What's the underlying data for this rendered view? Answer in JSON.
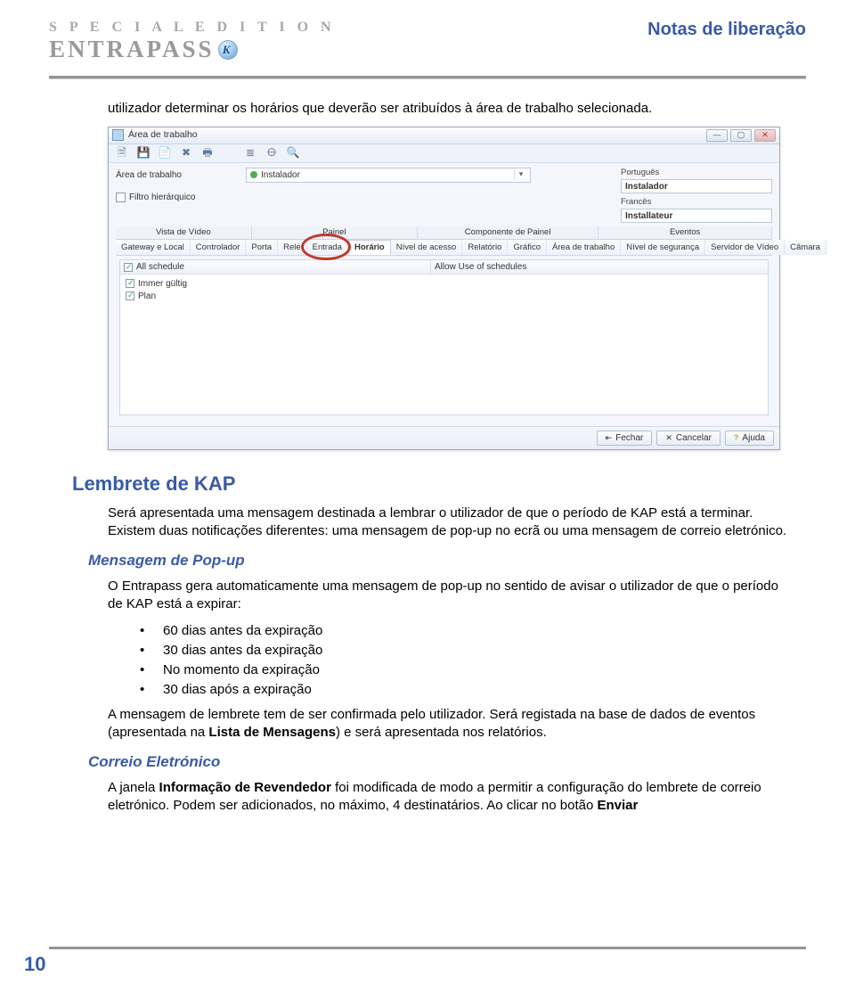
{
  "header": {
    "special_edition": "S P E C I A L   E D I T I O N",
    "brand": "ENTRAPASS",
    "brand_icon_letter": "K",
    "release_notes": "Notas de liberação"
  },
  "intro_paragraph": "utilizador determinar os horários que deverão ser atribuídos à área de trabalho selecionada.",
  "screenshot": {
    "window_title": "Área de trabalho",
    "toolbar_icons": [
      "new",
      "save",
      "folder",
      "delete",
      "print",
      "list",
      "org",
      "search"
    ],
    "labels": {
      "area_de_trabalho": "Área de trabalho",
      "filtro": "Filtro hierárquico"
    },
    "combo_value": "Instalador",
    "lang": {
      "pt_label": "Português",
      "pt_value": "Instalador",
      "fr_label": "Francês",
      "fr_value": "Installateur"
    },
    "tab_groups": [
      "Vista de Vídeo",
      "Painel",
      "Componente de Painel",
      "Eventos"
    ],
    "tabs": [
      "Gateway e Local",
      "Controlador",
      "Porta",
      "Relé",
      "Entrada",
      "Horário",
      "Nível de acesso",
      "Relatório",
      "Gráfico",
      "Área de trabalho",
      "Nível de segurança",
      "Servidor de Vídeo",
      "Câmara"
    ],
    "active_tab_index": 5,
    "all_schedule": "All schedule",
    "allow_use": "Allow Use of schedules",
    "list_items": [
      "Immer gültig",
      "Plan"
    ],
    "footer_buttons": [
      {
        "icon": "⇤",
        "label": "Fechar"
      },
      {
        "icon": "✕",
        "label": "Cancelar"
      },
      {
        "icon": "?",
        "label": "Ajuda"
      }
    ]
  },
  "section": {
    "heading": "Lembrete de KAP",
    "p1": "Será apresentada uma mensagem destinada a lembrar o utilizador de que o período de KAP está a terminar. Existem duas notificações diferentes: uma mensagem de pop-up no ecrã ou uma mensagem de correio eletrónico.",
    "sub1": "Mensagem de Pop-up",
    "p2": "O Entrapass gera automaticamente uma mensagem de pop-up no sentido de avisar o utilizador de que o período de KAP está a expirar:",
    "bullets": [
      "60 dias antes da expiração",
      "30 dias antes da expiração",
      "No momento da expiração",
      "30 dias após a expiração"
    ],
    "p3_a": "A mensagem de lembrete tem de ser confirmada pelo utilizador. Será registada na base de dados de eventos (apresentada na ",
    "p3_b": "Lista de Mensagens",
    "p3_c": ") e será apresentada nos relatórios.",
    "sub2": "Correio Eletrónico",
    "p4_a": "A janela ",
    "p4_b": "Informação de Revendedor",
    "p4_c": " foi modificada de modo a permitir a configuração do lembrete de correio eletrónico. Podem ser adicionados, no máximo, 4 destinatários. Ao clicar no botão ",
    "p4_d": "Enviar"
  },
  "page_number": "10"
}
